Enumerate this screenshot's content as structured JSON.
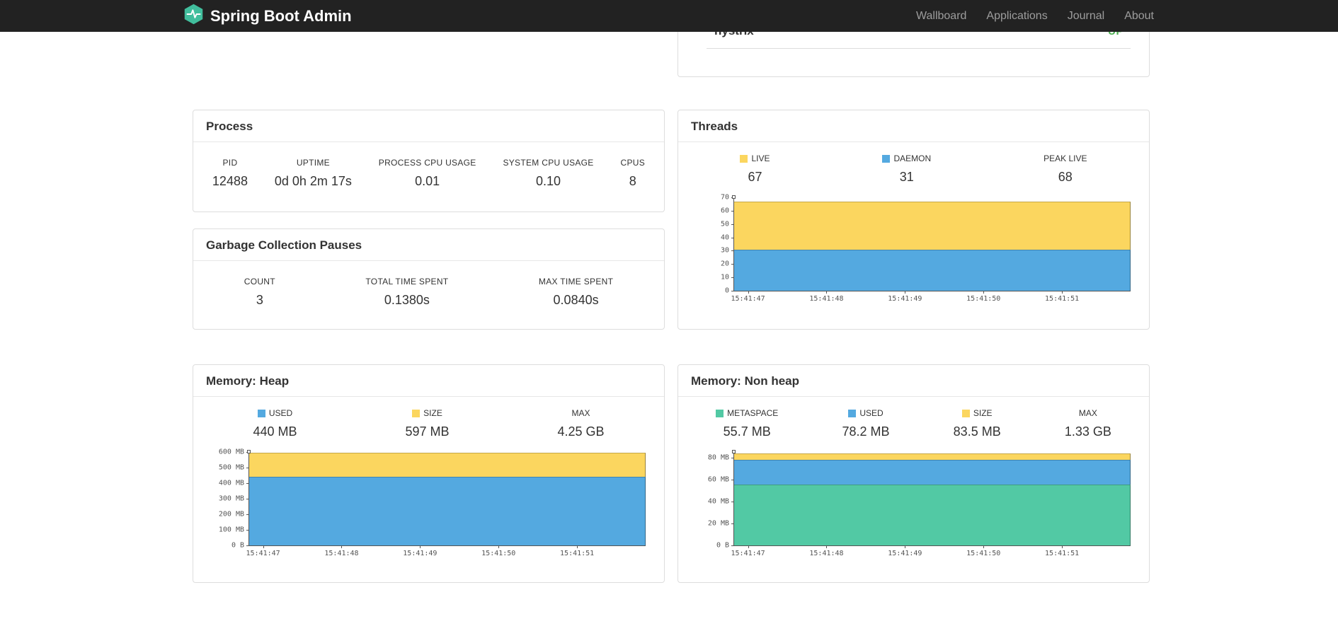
{
  "navbar": {
    "brand": "Spring Boot Admin",
    "brand_color": "#41be9d",
    "items": [
      {
        "label": "Wallboard"
      },
      {
        "label": "Applications"
      },
      {
        "label": "Journal"
      },
      {
        "label": "About"
      }
    ]
  },
  "application": {
    "name": "hystrix",
    "status": "UP",
    "status_color": "#4caf50"
  },
  "cards": {
    "process": {
      "title": "Process",
      "metrics": [
        {
          "label": "PID",
          "value": "12488"
        },
        {
          "label": "UPTIME",
          "value": "0d 0h 2m 17s"
        },
        {
          "label": "PROCESS CPU USAGE",
          "value": "0.01"
        },
        {
          "label": "SYSTEM CPU USAGE",
          "value": "0.10"
        },
        {
          "label": "CPUS",
          "value": "8"
        }
      ]
    },
    "gc": {
      "title": "Garbage Collection Pauses",
      "metrics": [
        {
          "label": "COUNT",
          "value": "3"
        },
        {
          "label": "TOTAL TIME SPENT",
          "value": "0.1380s"
        },
        {
          "label": "MAX TIME SPENT",
          "value": "0.0840s"
        }
      ]
    },
    "threads": {
      "title": "Threads",
      "legend": [
        {
          "label": "LIVE",
          "value": "67",
          "color": "#fbd65f"
        },
        {
          "label": "DAEMON",
          "value": "31",
          "color": "#54a9e0"
        },
        {
          "label": "PEAK LIVE",
          "value": "68",
          "color": ""
        }
      ]
    },
    "memory_heap": {
      "title": "Memory: Heap",
      "legend": [
        {
          "label": "USED",
          "value": "440 MB",
          "color": "#54a9e0"
        },
        {
          "label": "SIZE",
          "value": "597 MB",
          "color": "#fbd65f"
        },
        {
          "label": "MAX",
          "value": "4.25 GB",
          "color": ""
        }
      ]
    },
    "memory_nonheap": {
      "title": "Memory: Non heap",
      "legend": [
        {
          "label": "METASPACE",
          "value": "55.7 MB",
          "color": "#52c9a4"
        },
        {
          "label": "USED",
          "value": "78.2 MB",
          "color": "#54a9e0"
        },
        {
          "label": "SIZE",
          "value": "83.5 MB",
          "color": "#fbd65f"
        },
        {
          "label": "MAX",
          "value": "1.33 GB",
          "color": ""
        }
      ]
    }
  },
  "chart_data": [
    {
      "id": "threads",
      "type": "area",
      "title": "Threads",
      "x": [
        "15:41:47",
        "15:41:48",
        "15:41:49",
        "15:41:50",
        "15:41:51"
      ],
      "ymax": 70,
      "yticks": [
        {
          "v": 70,
          "label": "70"
        },
        {
          "v": 60,
          "label": "60"
        },
        {
          "v": 50,
          "label": "50"
        },
        {
          "v": 40,
          "label": "40"
        },
        {
          "v": 30,
          "label": "30"
        },
        {
          "v": 20,
          "label": "20"
        },
        {
          "v": 10,
          "label": "10"
        },
        {
          "v": 0,
          "label": "0"
        }
      ],
      "series": [
        {
          "name": "LIVE",
          "color": "#fbd65f",
          "values": [
            67,
            67,
            67,
            67,
            67
          ]
        },
        {
          "name": "DAEMON",
          "color": "#54a9e0",
          "values": [
            31,
            31,
            31,
            31,
            31
          ]
        }
      ]
    },
    {
      "id": "memory-heap",
      "type": "area",
      "title": "Memory: Heap",
      "x": [
        "15:41:47",
        "15:41:48",
        "15:41:49",
        "15:41:50",
        "15:41:51"
      ],
      "ymax": 600,
      "yticks": [
        {
          "v": 600,
          "label": "600 MB"
        },
        {
          "v": 500,
          "label": "500 MB"
        },
        {
          "v": 400,
          "label": "400 MB"
        },
        {
          "v": 300,
          "label": "300 MB"
        },
        {
          "v": 200,
          "label": "200 MB"
        },
        {
          "v": 100,
          "label": "100 MB"
        },
        {
          "v": 0,
          "label": "0 B"
        }
      ],
      "series": [
        {
          "name": "SIZE",
          "color": "#fbd65f",
          "values": [
            597,
            597,
            597,
            597,
            597
          ]
        },
        {
          "name": "USED",
          "color": "#54a9e0",
          "values": [
            430,
            432,
            435,
            438,
            440
          ]
        }
      ]
    },
    {
      "id": "memory-nonheap",
      "type": "area",
      "title": "Memory: Non heap",
      "x": [
        "15:41:47",
        "15:41:48",
        "15:41:49",
        "15:41:50",
        "15:41:51"
      ],
      "ymax": 85,
      "yticks": [
        {
          "v": 80,
          "label": "80 MB"
        },
        {
          "v": 60,
          "label": "60 MB"
        },
        {
          "v": 40,
          "label": "40 MB"
        },
        {
          "v": 20,
          "label": "20 MB"
        },
        {
          "v": 0,
          "label": "0 B"
        }
      ],
      "series": [
        {
          "name": "SIZE",
          "color": "#fbd65f",
          "values": [
            83.5,
            83.5,
            83.5,
            83.5,
            83.5
          ]
        },
        {
          "name": "USED",
          "color": "#54a9e0",
          "values": [
            78.2,
            78.2,
            78.2,
            78.2,
            78.2
          ]
        },
        {
          "name": "METASPACE",
          "color": "#52c9a4",
          "values": [
            55.7,
            55.7,
            55.7,
            55.7,
            55.7
          ]
        }
      ]
    }
  ]
}
